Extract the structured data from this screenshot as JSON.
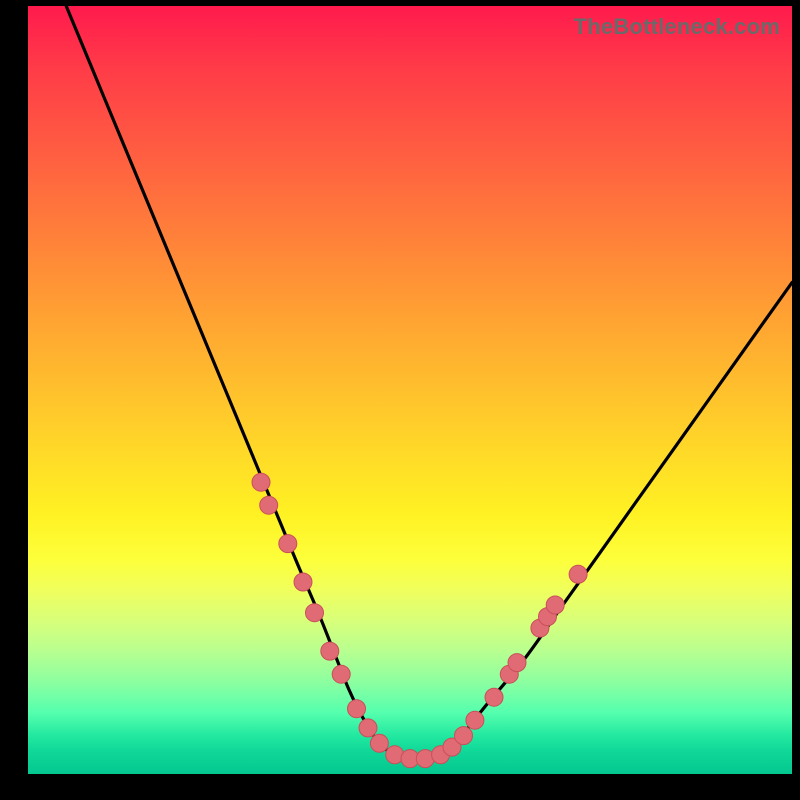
{
  "watermark": "TheBottleneck.com",
  "colors": {
    "frame": "#000000",
    "curve": "#000000",
    "marker_fill": "#e16b74",
    "marker_stroke": "#c94f59",
    "gradient_top": "#ff1a4d",
    "gradient_bottom": "#04c890"
  },
  "chart_data": {
    "type": "line",
    "title": "",
    "xlabel": "",
    "ylabel": "",
    "xlim": [
      0,
      100
    ],
    "ylim": [
      0,
      100
    ],
    "grid": false,
    "legend": false,
    "series": [
      {
        "name": "bottleneck-curve",
        "x": [
          5,
          10,
          15,
          20,
          25,
          30,
          35,
          38,
          40,
          42,
          44,
          46,
          48,
          50,
          52,
          54,
          56,
          58,
          60,
          65,
          70,
          75,
          80,
          85,
          90,
          95,
          100
        ],
        "y": [
          100,
          88,
          76,
          64,
          52,
          40,
          28,
          21,
          16,
          11,
          7,
          4,
          2.5,
          2,
          2,
          2.5,
          4,
          6.5,
          9,
          15,
          22,
          29,
          36,
          43,
          50,
          57,
          64
        ]
      }
    ],
    "markers": [
      {
        "x": 30.5,
        "y": 38
      },
      {
        "x": 31.5,
        "y": 35
      },
      {
        "x": 34,
        "y": 30
      },
      {
        "x": 36,
        "y": 25
      },
      {
        "x": 37.5,
        "y": 21
      },
      {
        "x": 39.5,
        "y": 16
      },
      {
        "x": 41,
        "y": 13
      },
      {
        "x": 43,
        "y": 8.5
      },
      {
        "x": 44.5,
        "y": 6
      },
      {
        "x": 46,
        "y": 4
      },
      {
        "x": 48,
        "y": 2.5
      },
      {
        "x": 50,
        "y": 2
      },
      {
        "x": 52,
        "y": 2
      },
      {
        "x": 54,
        "y": 2.5
      },
      {
        "x": 55.5,
        "y": 3.5
      },
      {
        "x": 57,
        "y": 5
      },
      {
        "x": 58.5,
        "y": 7
      },
      {
        "x": 61,
        "y": 10
      },
      {
        "x": 63,
        "y": 13
      },
      {
        "x": 64,
        "y": 14.5
      },
      {
        "x": 67,
        "y": 19
      },
      {
        "x": 68,
        "y": 20.5
      },
      {
        "x": 69,
        "y": 22
      },
      {
        "x": 72,
        "y": 26
      }
    ]
  }
}
